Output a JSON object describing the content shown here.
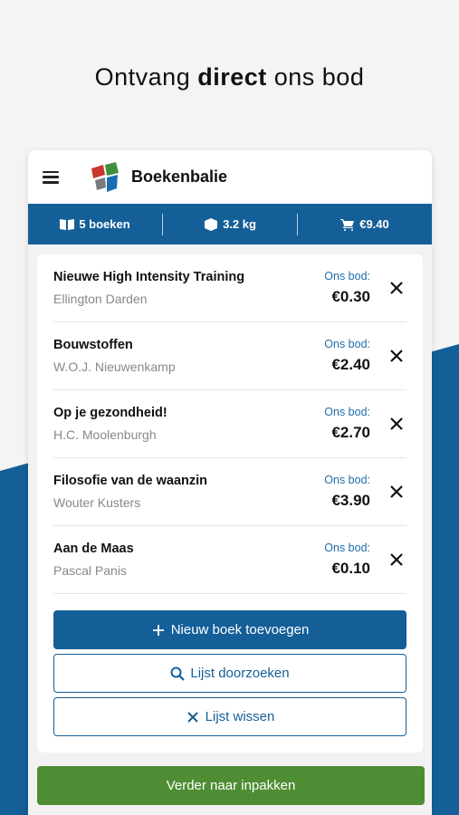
{
  "headline": {
    "prefix": "Ontvang ",
    "bold": "direct",
    "suffix": " ons bod"
  },
  "app": {
    "brand": "Boekenbalie"
  },
  "stats": {
    "books": "5 boeken",
    "weight": "3.2 kg",
    "total": "€9.40"
  },
  "books": [
    {
      "title": "Nieuwe High Intensity Training",
      "author": "Ellington Darden",
      "bid_label": "Ons bod:",
      "bid": "€0.30"
    },
    {
      "title": "Bouwstoffen",
      "author": "W.O.J. Nieuwenkamp",
      "bid_label": "Ons bod:",
      "bid": "€2.40"
    },
    {
      "title": "Op je gezondheid!",
      "author": "H.C. Moolenburgh",
      "bid_label": "Ons bod:",
      "bid": "€2.70"
    },
    {
      "title": "Filosofie van de waanzin",
      "author": "Wouter Kusters",
      "bid_label": "Ons bod:",
      "bid": "€3.90"
    },
    {
      "title": "Aan de Maas",
      "author": "Pascal Panis",
      "bid_label": "Ons bod:",
      "bid": "€0.10"
    }
  ],
  "actions": {
    "add": "Nieuw boek toevoegen",
    "search": "Lijst doorzoeken",
    "clear": "Lijst wissen",
    "next": "Verder naar inpakken"
  },
  "colors": {
    "primary": "#155f98",
    "green": "#4e8d33",
    "accent_text": "#1f6ea8"
  }
}
